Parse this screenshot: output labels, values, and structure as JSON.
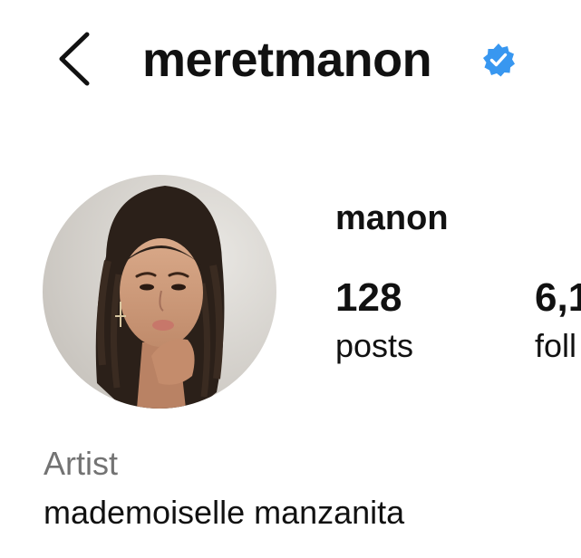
{
  "header": {
    "username": "meretmanon",
    "back_icon": "chevron-left-icon",
    "verified_icon": "verified-badge-icon",
    "verified_color": "#3897f0"
  },
  "profile": {
    "avatar_icon": "profile-photo",
    "display_name": "manon",
    "stats": {
      "posts": {
        "value": "128",
        "label": "posts"
      },
      "followers": {
        "value": "6,1",
        "label": "foll"
      }
    },
    "category": "Artist",
    "bio": "mademoiselle manzanita"
  }
}
